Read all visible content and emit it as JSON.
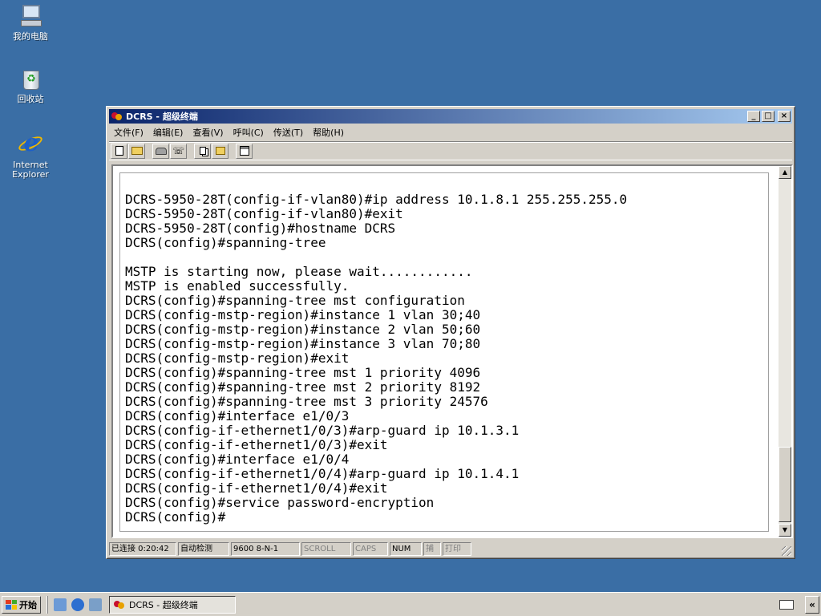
{
  "desktop": {
    "icons": [
      {
        "label": "我的电脑"
      },
      {
        "label": "回收站"
      },
      {
        "label": "Internet Explorer"
      }
    ]
  },
  "window": {
    "title": "DCRS - 超级终端",
    "controls": {
      "minimize": "_",
      "maximize": "□",
      "close": "×"
    },
    "menu": [
      "文件(F)",
      "编辑(E)",
      "查看(V)",
      "呼叫(C)",
      "传送(T)",
      "帮助(H)"
    ],
    "toolbar": [
      "new-icon",
      "open-icon",
      "dial-icon",
      "hangup-icon",
      "send-icon",
      "receive-icon",
      "properties-icon"
    ],
    "terminal_text": "DCRS-5950-28T(config-if-vlan80)#ip address 10.1.8.1 255.255.255.0\nDCRS-5950-28T(config-if-vlan80)#exit\nDCRS-5950-28T(config)#hostname DCRS\nDCRS(config)#spanning-tree\n\nMSTP is starting now, please wait............\nMSTP is enabled successfully.\nDCRS(config)#spanning-tree mst configuration\nDCRS(config-mstp-region)#instance 1 vlan 30;40\nDCRS(config-mstp-region)#instance 2 vlan 50;60\nDCRS(config-mstp-region)#instance 3 vlan 70;80\nDCRS(config-mstp-region)#exit\nDCRS(config)#spanning-tree mst 1 priority 4096\nDCRS(config)#spanning-tree mst 2 priority 8192\nDCRS(config)#spanning-tree mst 3 priority 24576\nDCRS(config)#interface e1/0/3\nDCRS(config-if-ethernet1/0/3)#arp-guard ip 10.1.3.1\nDCRS(config-if-ethernet1/0/3)#exit\nDCRS(config)#interface e1/0/4\nDCRS(config-if-ethernet1/0/4)#arp-guard ip 10.1.4.1\nDCRS(config-if-ethernet1/0/4)#exit\nDCRS(config)#service password-encryption\nDCRS(config)#",
    "status": {
      "connected": "已连接 0:20:42",
      "detect": "自动检测",
      "params": "9600 8-N-1",
      "scroll": "SCROLL",
      "caps": "CAPS",
      "num": "NUM",
      "capture": "捕",
      "print": "打印"
    }
  },
  "taskbar": {
    "start": "开始",
    "task": "DCRS - 超级终端",
    "tray_arrow": "«"
  }
}
